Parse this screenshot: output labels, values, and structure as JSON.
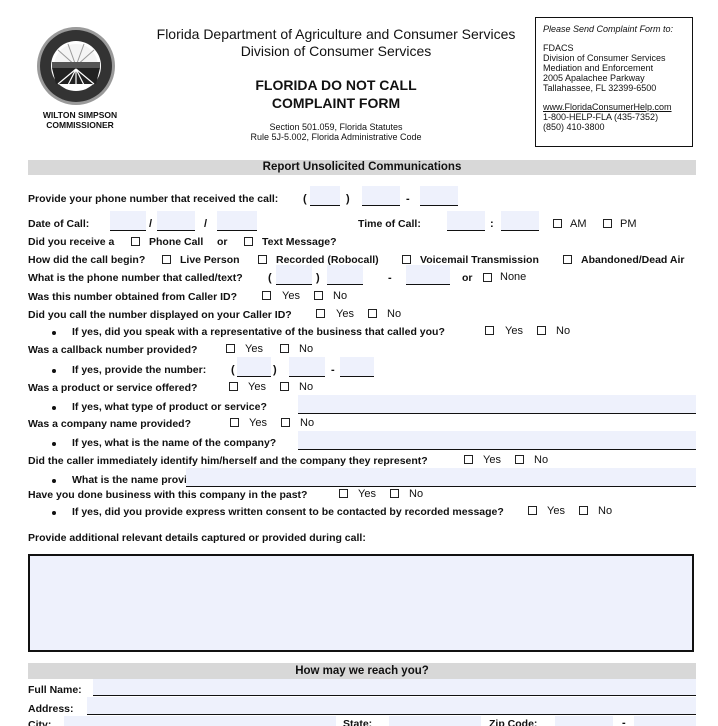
{
  "header": {
    "seal": "fdacs-seal-icon",
    "commissioner_name": "WILTON SIMPSON",
    "commissioner_title": "COMMISSIONER",
    "agency": "Florida Department of Agriculture and Consumer Services",
    "division": "Division of Consumer Services",
    "form_title_1": "FLORIDA DO NOT CALL",
    "form_title_2": "COMPLAINT FORM",
    "statute_1": "Section 501.059, Florida Statutes",
    "statute_2": "Rule 5J-5.002, Florida Administrative Code"
  },
  "mail_box": {
    "heading": "Please Send Complaint Form to:",
    "lines": [
      "FDACS",
      "Division of Consumer Services",
      "Mediation and Enforcement",
      "2005 Apalachee Parkway",
      "Tallahassee, FL 32399-6500"
    ],
    "website": "www.FloridaConsumerHelp.com",
    "phone_1": "1-800-HELP-FLA (435-7352)",
    "phone_2": "(850) 410-3800"
  },
  "section1": {
    "title": "Report Unsolicited Communications",
    "q_phone": "Provide your phone number that received the call:",
    "q_date": "Date of Call:",
    "q_time": "Time of Call:",
    "am": "AM",
    "pm": "PM",
    "q_receive": "Did you receive a",
    "phone_call": "Phone Call",
    "or": "or",
    "text_message": "Text Message?",
    "q_begin": "How did the call begin?",
    "begin_options": [
      "Live Person",
      "Recorded (Robocall)",
      "Voicemail Transmission",
      "Abandoned/Dead Air"
    ],
    "q_number": "What is the phone number that called/text?",
    "none": "None",
    "q_callerid": "Was this number obtained from Caller ID?",
    "q_called_back": "Did you call the number displayed on your Caller ID?",
    "q_speak": "If yes, did you speak with a representative of the business that called you?",
    "q_callback": "Was a callback number provided?",
    "q_provide_number": "If yes, provide the number:",
    "q_product": "Was a product or service offered?",
    "q_product_type": "If yes, what type of product or service?",
    "q_company": "Was a company name provided?",
    "q_company_name": "If yes, what is the name of the company?",
    "q_identify": "Did the caller immediately identify him/herself and the company they represent?",
    "q_name_provided": "What is the name provided?",
    "q_business": "Have you done business with this company in the past?",
    "q_consent": "If yes, did you provide express written consent to be contacted by recorded message?",
    "q_details": "Provide additional relevant details captured or provided during call:",
    "yes": "Yes",
    "no": "No",
    "paren_open": "(",
    "paren_close": ")",
    "dash": "-",
    "slash": "/",
    "colon": ":"
  },
  "section2": {
    "title": "How may we reach you?",
    "full_name": "Full Name:",
    "address": "Address:",
    "city": "City:",
    "state": "State:",
    "zip": "Zip Code:",
    "dash": "-"
  },
  "colors": {
    "field_fill": "#eef1fc",
    "section_bar": "#d8d8d8"
  }
}
